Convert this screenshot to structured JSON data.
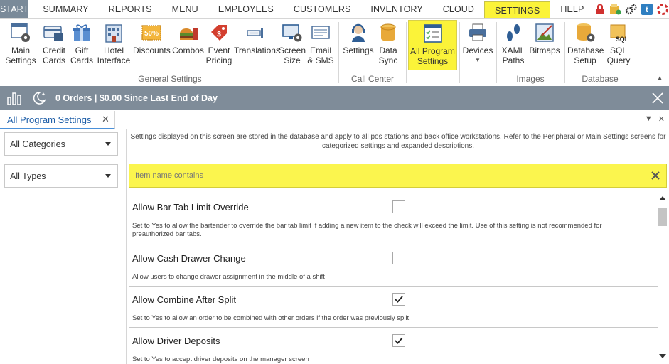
{
  "menu": {
    "tabs": [
      "START",
      "SUMMARY",
      "REPORTS",
      "MENU",
      "EMPLOYEES",
      "CUSTOMERS",
      "INVENTORY",
      "CLOUD",
      "SETTINGS",
      "HELP"
    ],
    "active_tab": "SETTINGS"
  },
  "ribbon": {
    "groups": {
      "general": "General Settings",
      "call_center": "Call Center",
      "images": "Images",
      "database": "Database"
    },
    "buttons": {
      "main_settings": "Main Settings",
      "credit_cards": "Credit Cards",
      "gift_cards": "Gift Cards",
      "hotel_interface": "Hotel Interface",
      "discounts": "Discounts",
      "combos": "Combos",
      "event_pricing": "Event Pricing",
      "translations": "Translations",
      "screen_size": "Screen Size",
      "email_sms": "Email & SMS",
      "cc_settings": "Settings",
      "data_sync": "Data Sync",
      "all_program_settings": "All Program Settings",
      "devices": "Devices",
      "xaml_paths": "XAML Paths",
      "bitmaps": "Bitmaps",
      "database_setup": "Database Setup",
      "sql_query": "SQL Query"
    },
    "icon_badge_50": "50%"
  },
  "status": {
    "text": "0 Orders | $0.00 Since Last End of Day"
  },
  "doc_tab": {
    "label": "All Program Settings"
  },
  "filters": {
    "category": "All Categories",
    "type": "All Types"
  },
  "info": "Settings displayed on this screen are stored in the database and apply to all pos stations and back office workstations. Refer to the Peripheral or Main Settings screens for categorized settings and expanded descriptions.",
  "search": {
    "placeholder": "Item name contains"
  },
  "settings": [
    {
      "name": "Allow Bar Tab Limit Override",
      "desc": "Set to Yes to allow the bartender to override the bar tab limit if adding a new item to the check will exceed the limit. Use of this setting is not recommended for preauthorized bar tabs.",
      "checked": false
    },
    {
      "name": "Allow Cash Drawer Change",
      "desc": "Allow users to change drawer assignment in the middle of a shift",
      "checked": false
    },
    {
      "name": "Allow Combine After Split",
      "desc": "Set to Yes to allow an order to be combined with other orders if the order was previously split",
      "checked": true
    },
    {
      "name": "Allow Driver Deposits",
      "desc": "Set to Yes to accept driver deposits on the manager screen",
      "checked": true
    }
  ],
  "colors": {
    "highlight": "#fbf339",
    "status_bar": "#7f8c99",
    "start_tab": "#7a8a99",
    "tab_text": "#1f5fa8"
  }
}
